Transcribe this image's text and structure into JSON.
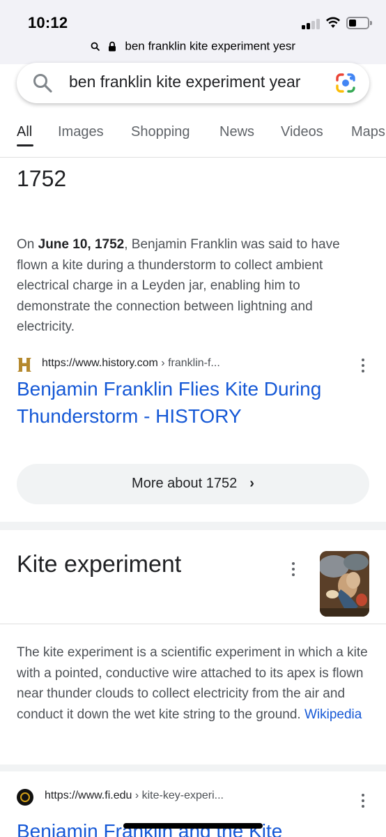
{
  "status_bar": {
    "time": "10:12"
  },
  "url_bar": {
    "text": "ben franklin kite experiment yesr"
  },
  "search": {
    "query": "ben franklin kite experiment year"
  },
  "tabs": [
    {
      "label": "All",
      "active": true
    },
    {
      "label": "Images"
    },
    {
      "label": "Shopping"
    },
    {
      "label": "News"
    },
    {
      "label": "Videos"
    },
    {
      "label": "Maps"
    }
  ],
  "featured_snippet": {
    "answer": "1752",
    "text_prefix": "On ",
    "text_bold": "June 10, 1752",
    "text_suffix": ", Benjamin Franklin was said to have flown a kite during a thunderstorm to collect ambient electrical charge in a Leyden jar, enabling him to demonstrate the connection between lightning and electricity.",
    "source_domain": "https://www.history.com",
    "source_crumb": " › franklin-f...",
    "result_title": "Benjamin Franklin Flies Kite During Thunderstorm - HISTORY",
    "more_button": "More about 1752",
    "more_chevron": "›"
  },
  "knowledge_panel": {
    "title": "Kite experiment",
    "description": "The kite experiment is a scientific experiment in which a kite with a pointed, conductive wire attached to its apex is flown near thunder clouds to collect electricity from the air and conduct it down the wet kite string to the ground. ",
    "source_link": "Wikipedia"
  },
  "next_result": {
    "domain": "https://www.fi.edu",
    "crumb": " › kite-key-experi...",
    "title": "Benjamin Franklin and the Kite"
  },
  "colors": {
    "link": "#1558d6",
    "text": "#202124",
    "snippet_text": "#4d5156",
    "history_logo": "#b5892e"
  }
}
